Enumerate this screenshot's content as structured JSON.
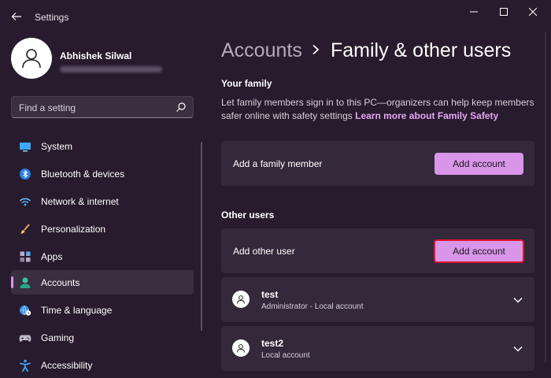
{
  "window": {
    "title": "Settings",
    "back_icon": "arrow-left-icon",
    "controls": [
      "minimize-icon",
      "maximize-icon",
      "close-icon"
    ]
  },
  "profile": {
    "name": "Abhishek Silwal",
    "email_obscured": true
  },
  "search": {
    "placeholder": "Find a setting",
    "icon": "search-icon"
  },
  "sidebar": {
    "items": [
      {
        "label": "System",
        "icon": "monitor-icon",
        "active": false
      },
      {
        "label": "Bluetooth & devices",
        "icon": "bluetooth-icon",
        "active": false
      },
      {
        "label": "Network & internet",
        "icon": "wifi-icon",
        "active": false
      },
      {
        "label": "Personalization",
        "icon": "paintbrush-icon",
        "active": false
      },
      {
        "label": "Apps",
        "icon": "apps-icon",
        "active": false
      },
      {
        "label": "Accounts",
        "icon": "person-icon",
        "active": true
      },
      {
        "label": "Time & language",
        "icon": "globe-clock-icon",
        "active": false
      },
      {
        "label": "Gaming",
        "icon": "gamepad-icon",
        "active": false
      },
      {
        "label": "Accessibility",
        "icon": "accessibility-icon",
        "active": false
      }
    ]
  },
  "breadcrumb": {
    "parent": "Accounts",
    "current": "Family & other users"
  },
  "your_family": {
    "title": "Your family",
    "description": "Let family members sign in to this PC—organizers can help keep members safer online with safety settings",
    "link": "Learn more about Family Safety",
    "add_label": "Add a family member",
    "add_button": "Add account"
  },
  "other_users": {
    "title": "Other users",
    "add_label": "Add other user",
    "add_button": "Add account",
    "users": [
      {
        "name": "test",
        "detail": "Administrator - Local account"
      },
      {
        "name": "test2",
        "detail": "Local account"
      }
    ]
  },
  "colors": {
    "background": "#271b2d",
    "card": "#34283b",
    "accent": "#d996e9",
    "highlight_border": "#e01531"
  }
}
